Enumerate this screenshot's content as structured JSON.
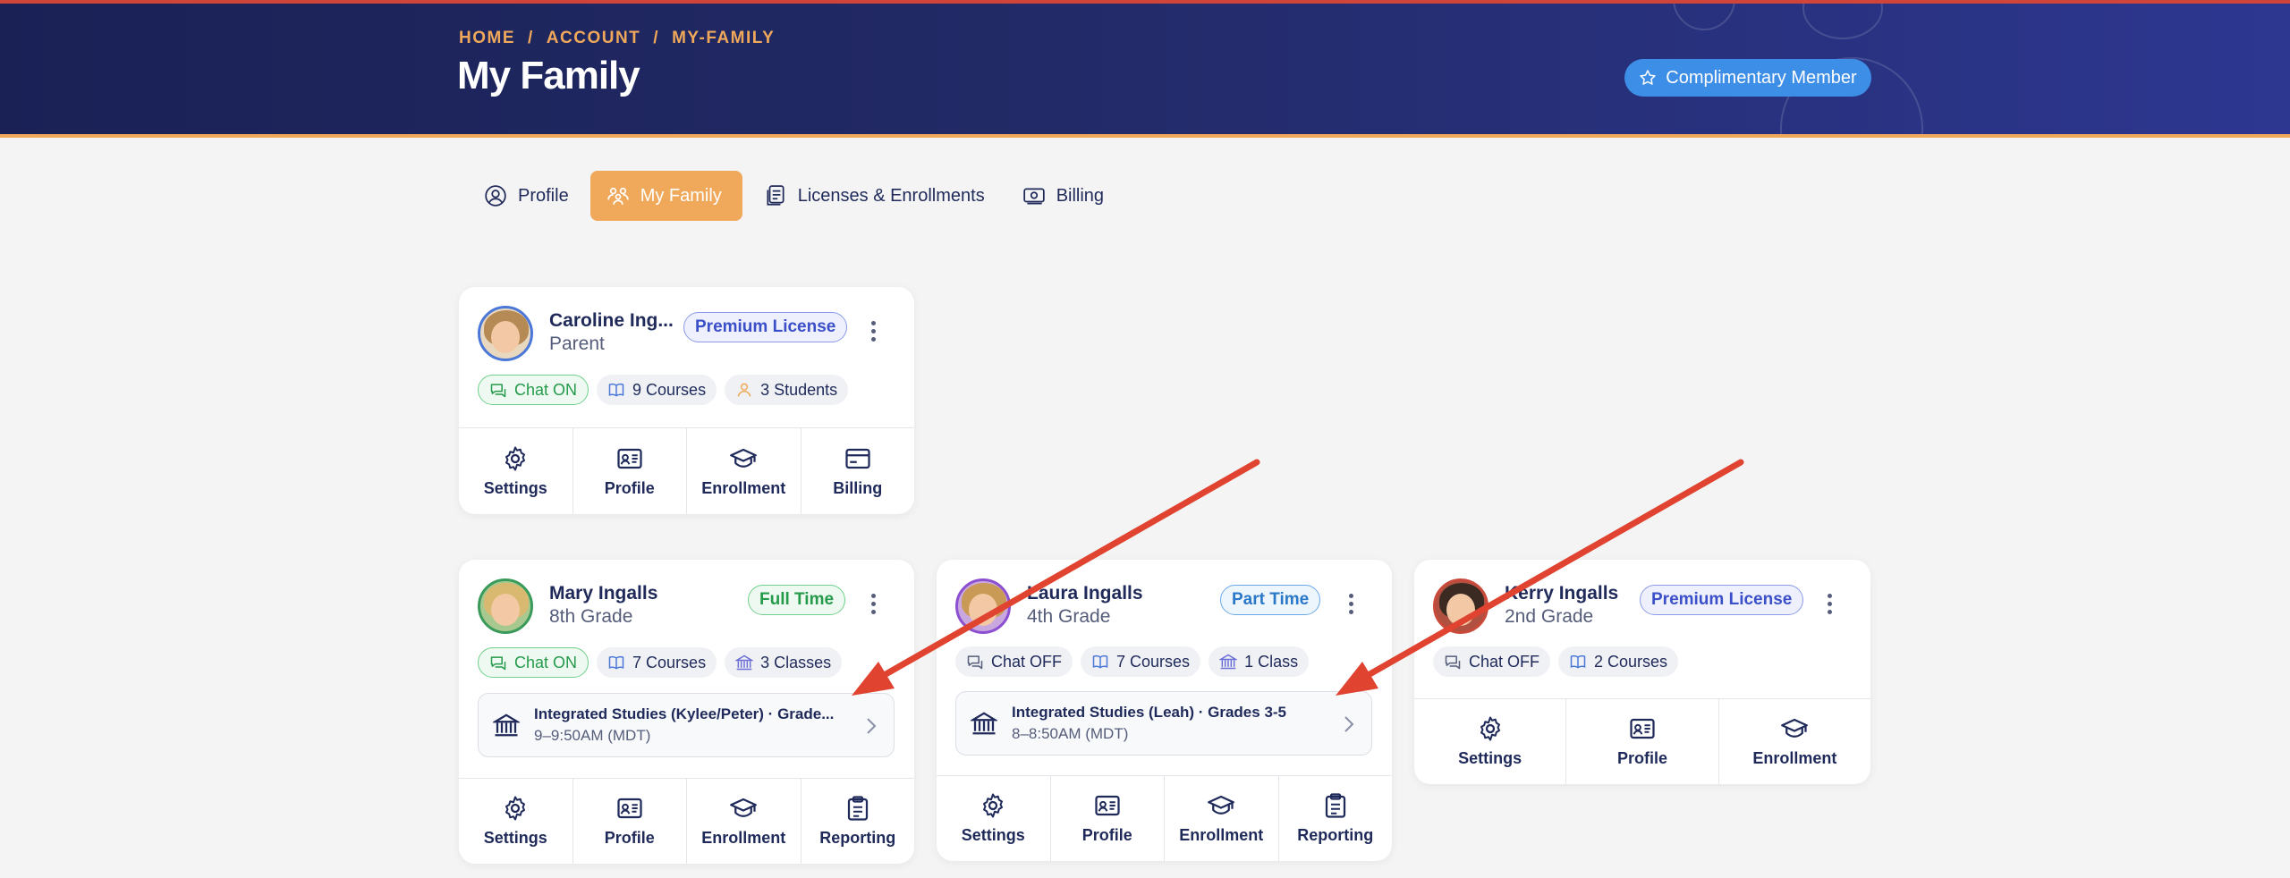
{
  "header": {
    "breadcrumb": [
      "HOME",
      "ACCOUNT",
      "MY-FAMILY"
    ],
    "title": "My Family",
    "member_badge": "Complimentary Member"
  },
  "tabs": [
    {
      "label": "Profile",
      "icon": "user-circle-icon",
      "active": false
    },
    {
      "label": "My Family",
      "icon": "family-icon",
      "active": true
    },
    {
      "label": "Licenses & Enrollments",
      "icon": "documents-icon",
      "active": false
    },
    {
      "label": "Billing",
      "icon": "money-icon",
      "active": false
    }
  ],
  "parent": {
    "name": "Caroline Ing...",
    "role": "Parent",
    "license": "Premium License",
    "chips": [
      "Chat ON",
      "9 Courses",
      "3 Students"
    ],
    "actions": [
      "Settings",
      "Profile",
      "Enrollment",
      "Billing"
    ]
  },
  "students": [
    {
      "name": "Mary Ingalls",
      "role": "8th Grade",
      "license": "Full Time",
      "chips": [
        "Chat ON",
        "7 Courses",
        "3 Classes"
      ],
      "class_title": "Integrated Studies (Kylee/Peter) · Grade...",
      "class_time": "9–9:50AM (MDT)",
      "actions": [
        "Settings",
        "Profile",
        "Enrollment",
        "Reporting"
      ]
    },
    {
      "name": "Laura Ingalls",
      "role": "4th Grade",
      "license": "Part Time",
      "chips": [
        "Chat OFF",
        "7 Courses",
        "1 Class"
      ],
      "class_title": "Integrated Studies (Leah) · Grades 3-5",
      "class_time": "8–8:50AM (MDT)",
      "actions": [
        "Settings",
        "Profile",
        "Enrollment",
        "Reporting"
      ]
    },
    {
      "name": "Kerry Ingalls",
      "role": "2nd Grade",
      "license": "Premium License",
      "chips": [
        "Chat OFF",
        "2 Courses"
      ],
      "actions": [
        "Settings",
        "Profile",
        "Enrollment"
      ]
    }
  ],
  "colors": {
    "header_bg": "#1a2155",
    "accent_orange": "#f0a85a",
    "badge_blue": "#3d8ee6",
    "arrow_red": "#e0432f"
  }
}
